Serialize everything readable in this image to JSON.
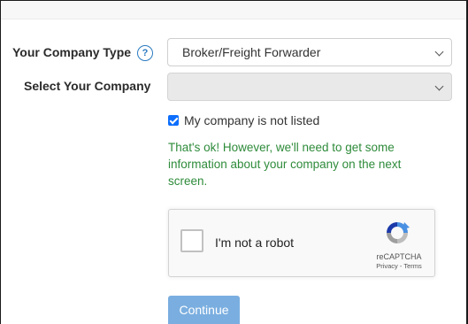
{
  "form": {
    "company_type": {
      "label": "Your Company Type",
      "help_icon": "question-circle-icon",
      "selected_value": "Broker/Freight Forwarder"
    },
    "select_company": {
      "label": "Select Your Company",
      "selected_value": ""
    },
    "not_listed_checkbox": {
      "label": "My company is not listed",
      "checked": true
    },
    "note": "That's ok! However, we'll need to get some information about your company on the next screen.",
    "recaptcha": {
      "label": "I'm not a robot",
      "brand": "reCAPTCHA",
      "links": "Privacy - Terms"
    },
    "continue_label": "Continue"
  },
  "colors": {
    "accent_blue": "#0d6efd",
    "help_icon": "#2a7ac0",
    "note_green": "#2e8b3a",
    "continue_button": "#7aaee0"
  }
}
